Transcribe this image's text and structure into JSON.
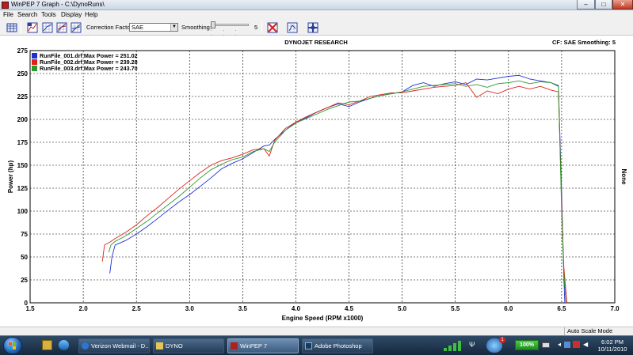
{
  "window": {
    "title": "WinPEP 7     Graph - C:\\DynoRuns\\",
    "minimize_label": "–",
    "maximize_label": "□",
    "close_label": "✕"
  },
  "menu": [
    "File",
    "Search",
    "Tools",
    "Display",
    "Help"
  ],
  "toolbar": {
    "correction_factor_label": "Correction Factor:",
    "correction_factor_value": "SAE",
    "smoothing_label": "Smoothing:",
    "smoothing_value": "5",
    "smoothing_ticks": ". . . . . ."
  },
  "graph": {
    "header_center": "DYNOJET RESEARCH",
    "header_right": "CF: SAE  Smoothing: 5",
    "right_axis_label": "None"
  },
  "chart_data": {
    "type": "line",
    "xlabel": "Engine Speed (RPM x1000)",
    "ylabel": "Power (hp)",
    "xlim": [
      1.5,
      7.0
    ],
    "ylim": [
      0,
      275
    ],
    "xticks": [
      "1.5",
      "2.0",
      "2.5",
      "3.0",
      "3.5",
      "4.0",
      "4.5",
      "5.0",
      "5.5",
      "6.0",
      "6.5",
      "7.0"
    ],
    "yticks": [
      "0",
      "25",
      "50",
      "75",
      "100",
      "125",
      "150",
      "175",
      "200",
      "225",
      "250",
      "275"
    ],
    "grid": true,
    "legend_position": "top-left",
    "series": [
      {
        "name": "RunFile_001.drf Max Power = 251.02",
        "color": "#1f2fd8",
        "x": [
          2.25,
          2.27,
          2.3,
          2.4,
          2.5,
          2.6,
          2.7,
          2.8,
          2.9,
          3.0,
          3.1,
          3.2,
          3.3,
          3.4,
          3.5,
          3.6,
          3.7,
          3.75,
          3.8,
          3.9,
          4.0,
          4.1,
          4.2,
          4.3,
          4.4,
          4.5,
          4.6,
          4.7,
          4.8,
          4.9,
          5.0,
          5.1,
          5.2,
          5.3,
          5.4,
          5.5,
          5.6,
          5.7,
          5.8,
          5.9,
          6.0,
          6.1,
          6.2,
          6.3,
          6.4,
          6.47,
          6.5,
          6.52,
          6.53
        ],
        "y": [
          32,
          50,
          63,
          68,
          75,
          83,
          92,
          101,
          110,
          118,
          127,
          136,
          146,
          152,
          157,
          164,
          171,
          172,
          178,
          188,
          197,
          202,
          208,
          213,
          217,
          214,
          219,
          223,
          226,
          228,
          230,
          237,
          240,
          236,
          239,
          241,
          238,
          244,
          243,
          245,
          247,
          248,
          244,
          242,
          240,
          236,
          120,
          30,
          0
        ]
      },
      {
        "name": "RunFile_002.drf Max Power = 239.28",
        "color": "#e0201a",
        "x": [
          2.18,
          2.2,
          2.25,
          2.3,
          2.4,
          2.5,
          2.6,
          2.7,
          2.8,
          2.9,
          3.0,
          3.1,
          3.2,
          3.3,
          3.4,
          3.5,
          3.6,
          3.7,
          3.75,
          3.8,
          3.9,
          4.0,
          4.1,
          4.2,
          4.3,
          4.4,
          4.5,
          4.6,
          4.7,
          4.8,
          4.9,
          5.0,
          5.1,
          5.2,
          5.3,
          5.4,
          5.5,
          5.6,
          5.7,
          5.8,
          5.9,
          6.0,
          6.1,
          6.2,
          6.3,
          6.4,
          6.47,
          6.5,
          6.52,
          6.55
        ],
        "y": [
          45,
          63,
          66,
          70,
          77,
          85,
          95,
          104,
          114,
          124,
          133,
          142,
          150,
          155,
          158,
          162,
          167,
          168,
          160,
          177,
          190,
          197,
          203,
          208,
          213,
          218,
          216,
          220,
          225,
          227,
          229,
          229,
          231,
          233,
          235,
          236,
          237,
          240,
          224,
          231,
          228,
          233,
          236,
          233,
          236,
          232,
          230,
          110,
          40,
          0
        ]
      },
      {
        "name": "RunFile_003.drf Max Power = 243.70",
        "color": "#2a9a2a",
        "x": [
          2.24,
          2.26,
          2.3,
          2.4,
          2.5,
          2.6,
          2.7,
          2.8,
          2.9,
          3.0,
          3.1,
          3.2,
          3.3,
          3.4,
          3.5,
          3.6,
          3.7,
          3.75,
          3.8,
          3.9,
          4.0,
          4.1,
          4.2,
          4.3,
          4.4,
          4.5,
          4.6,
          4.7,
          4.8,
          4.9,
          5.0,
          5.1,
          5.2,
          5.3,
          5.4,
          5.5,
          5.6,
          5.7,
          5.8,
          5.9,
          6.0,
          6.1,
          6.2,
          6.3,
          6.4,
          6.47,
          6.5,
          6.52,
          6.54
        ],
        "y": [
          55,
          63,
          67,
          73,
          81,
          89,
          98,
          107,
          116,
          126,
          136,
          145,
          151,
          156,
          159,
          165,
          168,
          165,
          175,
          188,
          196,
          201,
          206,
          211,
          215,
          219,
          220,
          223,
          226,
          228,
          230,
          233,
          236,
          237,
          238,
          239,
          236,
          238,
          235,
          239,
          240,
          242,
          239,
          241,
          240,
          237,
          100,
          35,
          0
        ]
      }
    ]
  },
  "statusbar": {
    "mode": "Auto Scale Mode"
  },
  "taskbar": {
    "tasks": [
      "Verizon Webmail - D...",
      "DYNO",
      "WinPEP 7",
      "Adobe Photoshop"
    ],
    "battery": "100%",
    "time": "6:02 PM",
    "date": "10/11/2010"
  }
}
